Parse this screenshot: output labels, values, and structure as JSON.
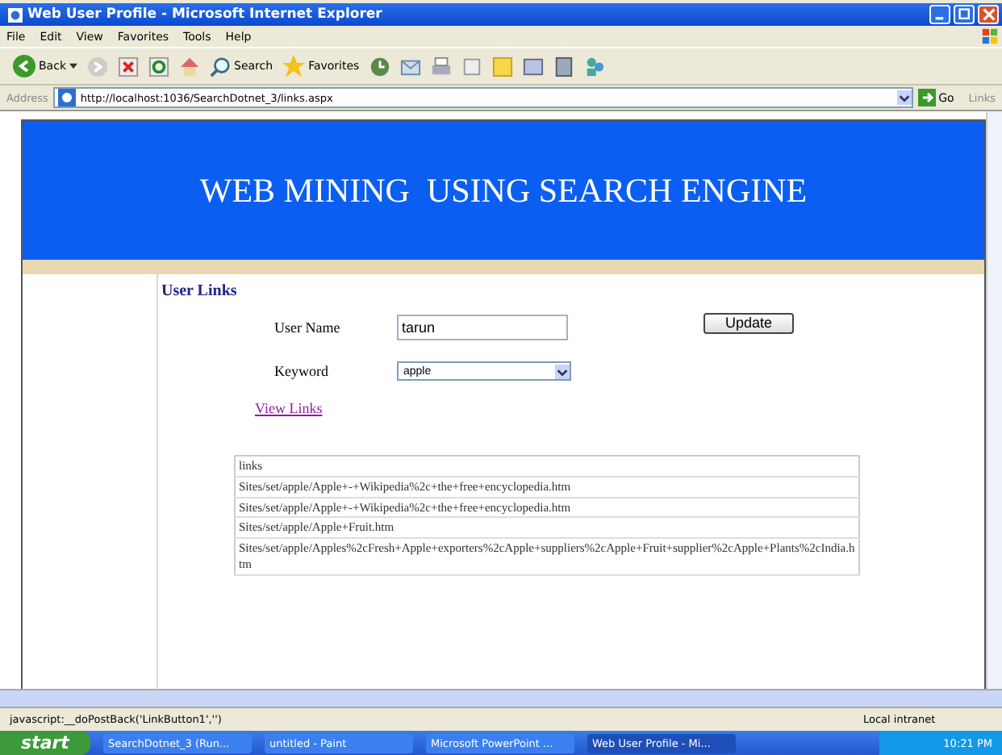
{
  "window": {
    "title": "Web User Profile - Microsoft Internet Explorer"
  },
  "menu": [
    "File",
    "Edit",
    "View",
    "Favorites",
    "Tools",
    "Help"
  ],
  "toolbar": {
    "back": "Back",
    "search": "Search",
    "favorites": "Favorites"
  },
  "address_bar": {
    "label": "Address",
    "url": "http://localhost:1036/SearchDotnet_3/links.aspx",
    "go": "Go",
    "links": "Links"
  },
  "page": {
    "banner": "WEB MINING  USING SEARCH ENGINE",
    "heading": "User Links",
    "user_name": {
      "label": "User Name",
      "value": "tarun"
    },
    "update_button": "Update",
    "keyword": {
      "label": "Keyword",
      "value": "apple"
    },
    "view_links": "View Links",
    "table": {
      "header": "links",
      "rows": [
        "Sites/set/apple/Apple+-+Wikipedia%2c+the+free+encyclopedia.htm",
        "Sites/set/apple/Apple+-+Wikipedia%2c+the+free+encyclopedia.htm",
        "Sites/set/apple/Apple+Fruit.htm",
        "Sites/set/apple/Apples%2cFresh+Apple+exporters%2cApple+suppliers%2cApple+Fruit+supplier%2cApple+Plants%2cIndia.htm"
      ]
    }
  },
  "status_bar": {
    "text": "javascript:__doPostBack('LinkButton1','')",
    "zone": "Local intranet"
  },
  "taskbar": {
    "start": "start",
    "items": [
      {
        "label": "SearchDotnet_3 (Run...",
        "selected": false
      },
      {
        "label": "untitled - Paint",
        "selected": false
      },
      {
        "label": "Microsoft PowerPoint ...",
        "selected": false
      },
      {
        "label": "Web User Profile - Mi...",
        "selected": true
      }
    ],
    "time": "10:21 PM"
  }
}
